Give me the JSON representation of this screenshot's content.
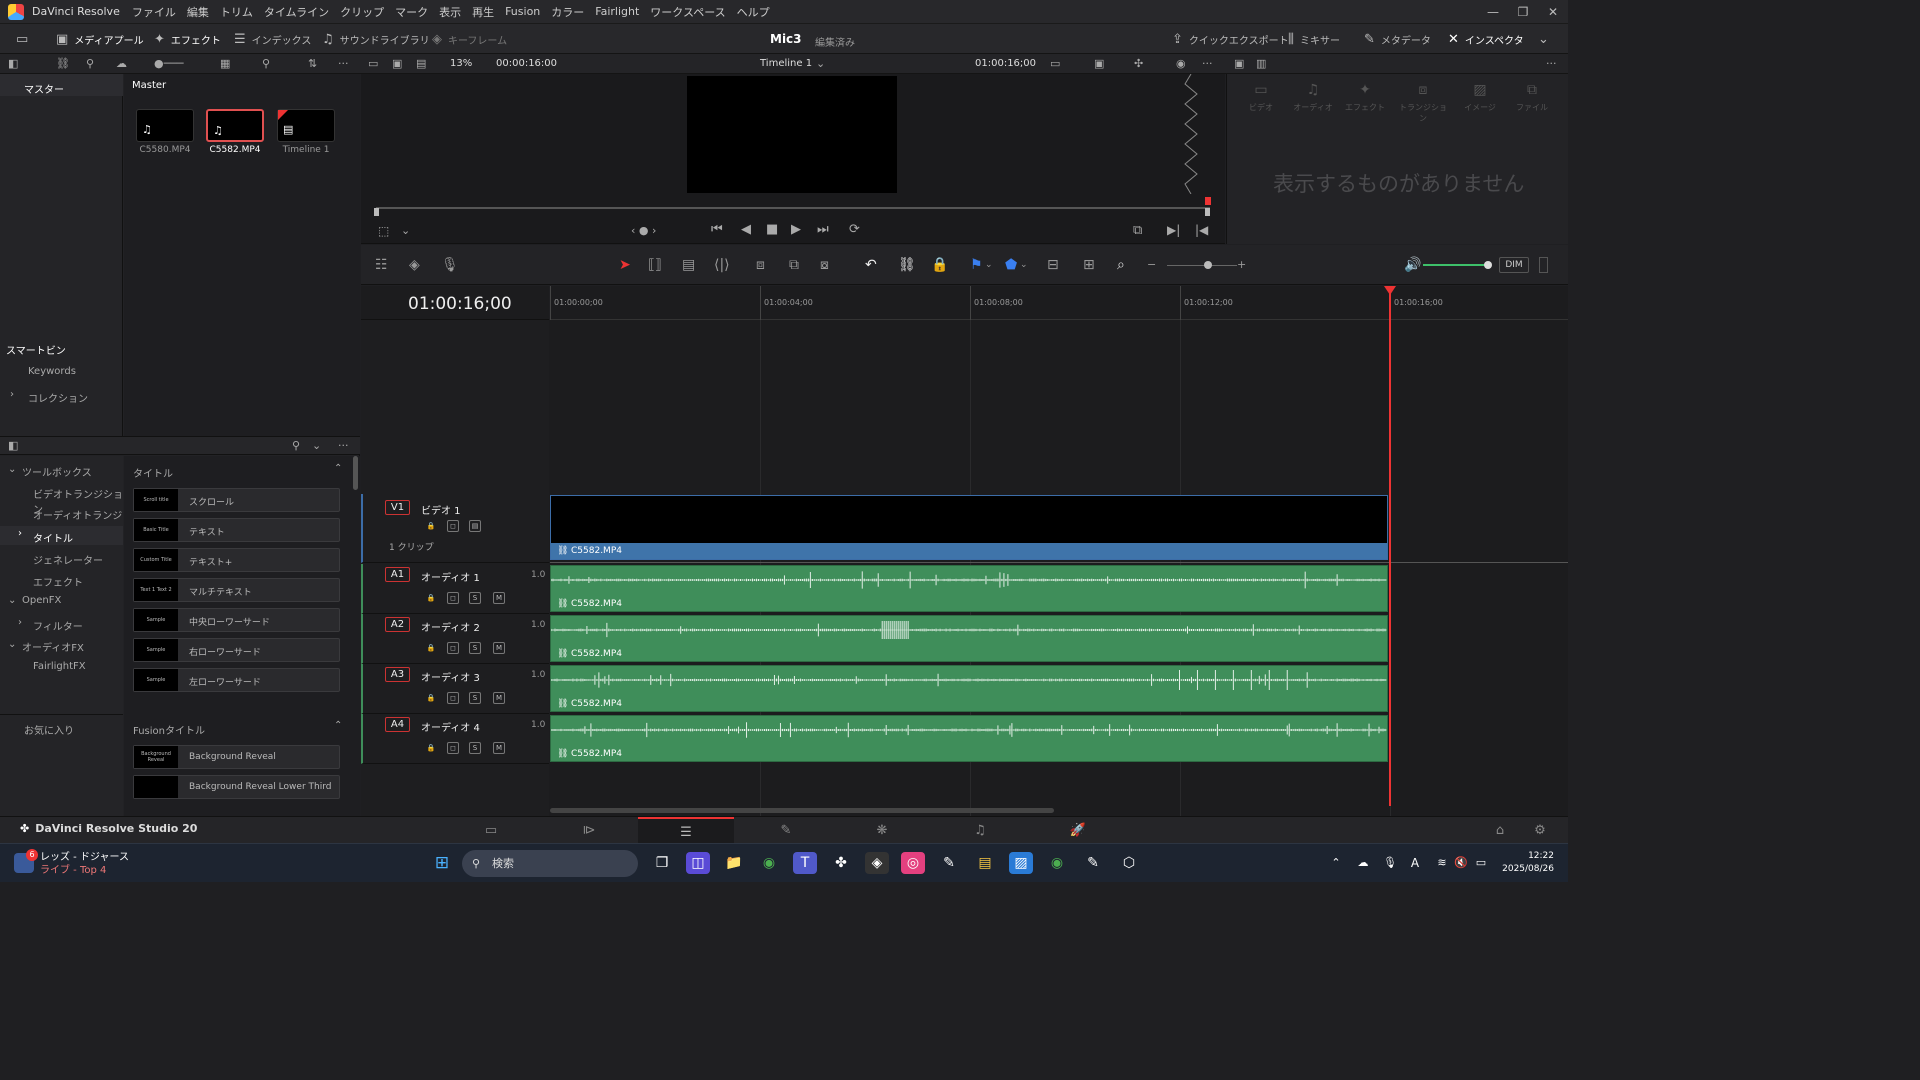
{
  "menubar": {
    "app_name": "DaVinci Resolve",
    "items": [
      "ファイル",
      "編集",
      "トリム",
      "タイムライン",
      "クリップ",
      "マーク",
      "表示",
      "再生",
      "Fusion",
      "カラー",
      "Fairlight",
      "ワークスペース",
      "ヘルプ"
    ]
  },
  "toolbar": {
    "media_pool": "メディアプール",
    "effects": "エフェクト",
    "index": "インデックス",
    "sound_library": "サウンドライブラリ",
    "keyframe": "キーフレーム",
    "project_name": "Mic3",
    "project_status": "編集済み",
    "quick_export": "クイックエクスポート",
    "mixer": "ミキサー",
    "metadata": "メタデータ",
    "inspector": "インスペクタ"
  },
  "subbar": {
    "zoom": "13%",
    "source_timecode": "00:00:16:00",
    "timeline_name": "Timeline 1",
    "timeline_timecode": "01:00:16;00"
  },
  "bins": {
    "master": "マスター",
    "smart_bins": "スマートビン",
    "keywords": "Keywords",
    "collections": "コレクション"
  },
  "media": {
    "header": "Master",
    "clips": [
      {
        "name": "C5580.MP4",
        "kind": "audio"
      },
      {
        "name": "C5582.MP4",
        "kind": "audio"
      },
      {
        "name": "Timeline 1",
        "kind": "timeline"
      }
    ]
  },
  "effects_tree": {
    "toolbox": "ツールボックス",
    "video_transitions": "ビデオトランジション",
    "audio_transitions": "オーディオトランジシ...",
    "titles": "タイトル",
    "generators": "ジェネレーター",
    "effects": "エフェクト",
    "openfx": "OpenFX",
    "filters": "フィルター",
    "audiofx": "オーディオFX",
    "fairlightfx": "FairlightFX",
    "favorites": "お気に入り"
  },
  "effects_list": {
    "section_titles": "タイトル",
    "titles": [
      {
        "label": "スクロール",
        "thumb": "Scroll title"
      },
      {
        "label": "テキスト",
        "thumb": "Basic Title"
      },
      {
        "label": "テキスト+",
        "thumb": "Custom Title"
      },
      {
        "label": "マルチテキスト",
        "thumb": "Text 1 Text 2"
      },
      {
        "label": "中央ローワーサード",
        "thumb": "Sample"
      },
      {
        "label": "右ローワーサード",
        "thumb": "Sample"
      },
      {
        "label": "左ローワーサード",
        "thumb": "Sample"
      }
    ],
    "section_fusion": "Fusionタイトル",
    "fusion_titles": [
      {
        "label": "Background Reveal",
        "thumb": "Background Reveal"
      },
      {
        "label": "Background Reveal Lower Third",
        "thumb": ""
      }
    ]
  },
  "inspector": {
    "tabs": [
      "ビデオ",
      "オーディオ",
      "エフェクト",
      "トランジション",
      "イメージ",
      "ファイル"
    ],
    "empty_message": "表示するものがありません"
  },
  "timeline": {
    "timecode": "01:00:16;00",
    "ruler": [
      "01:00:00;00",
      "01:00:04;00",
      "01:00:08;00",
      "01:00:12;00",
      "01:00:16;00"
    ],
    "video_track": {
      "id": "V1",
      "name": "ビデオ 1",
      "clip_count": "1 クリップ",
      "clip": "C5582.MP4"
    },
    "audio_tracks": [
      {
        "id": "A1",
        "name": "オーディオ 1",
        "vol": "1.0",
        "clip": "C5582.MP4"
      },
      {
        "id": "A2",
        "name": "オーディオ 2",
        "vol": "1.0",
        "clip": "C5582.MP4"
      },
      {
        "id": "A3",
        "name": "オーディオ 3",
        "vol": "1.0",
        "clip": "C5582.MP4"
      },
      {
        "id": "A4",
        "name": "オーディオ 4",
        "vol": "1.0",
        "clip": "C5582.MP4"
      }
    ],
    "dim_label": "DIM",
    "solo_label": "S",
    "mute_label": "M"
  },
  "pagebar": {
    "brand": "DaVinci Resolve Studio 20"
  },
  "taskbar": {
    "news_title": "レッズ - ドジャース",
    "news_sub": "ライブ - Top 4",
    "news_badge": "6",
    "search": "検索",
    "time": "12:22",
    "date": "2025/08/26"
  },
  "colors": {
    "accent": "#e33333",
    "video_clip": "#3f74aa",
    "audio_clip": "#3f8e5a"
  }
}
